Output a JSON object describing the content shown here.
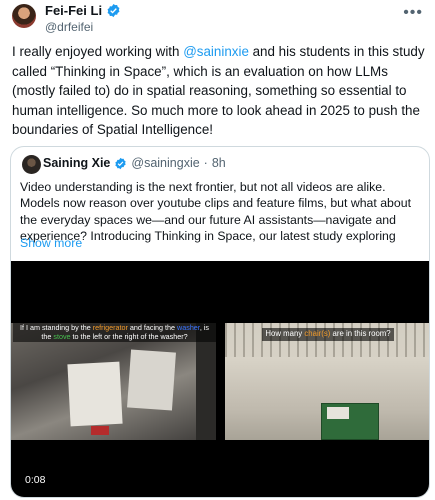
{
  "tweet": {
    "author_name": "Fei-Fei Li",
    "author_handle": "@drfeifei",
    "more_icon": "more-options-icon",
    "text_prefix": "I really enjoyed working with ",
    "mention": "@saininxie",
    "text_suffix": " and his students in this study called “Thinking in Space”, which is an evaluation on how LLMs (mostly failed to) do in spatial reasoning, something so essential to human intelligence. So much more to look ahead in 2025 to push the boundaries of Spatial Intelligence!"
  },
  "quote": {
    "author_name": "Saining Xie",
    "author_handle": "@sainingxie",
    "separator": "·",
    "time": "8h",
    "text": "Video understanding is the next frontier, but not all videos are alike. Models now reason over youtube clips and feature films, but what about the everyday spaces we—and our future AI assistants—navigate and experience? Introducing Thinking in Space, our latest study exploring",
    "show_more": "Show more"
  },
  "video": {
    "time_label": "0:08",
    "left_caption": {
      "p1": "If I am standing by the ",
      "w1": "refrigerator",
      "p2": " and facing the ",
      "w2": "washer",
      "p3": ", is the ",
      "w3": "stove",
      "p4": " to the left or the right of the washer?"
    },
    "right_caption": {
      "p1": "How many ",
      "w1": "chair(s)",
      "p2": " are in this room?"
    }
  },
  "colors": {
    "accent": "#1d9bf0",
    "verified": "#1d9bf0",
    "highlight_orange": "#f29b2b",
    "highlight_blue": "#3b74ff",
    "highlight_green": "#48c04f"
  }
}
